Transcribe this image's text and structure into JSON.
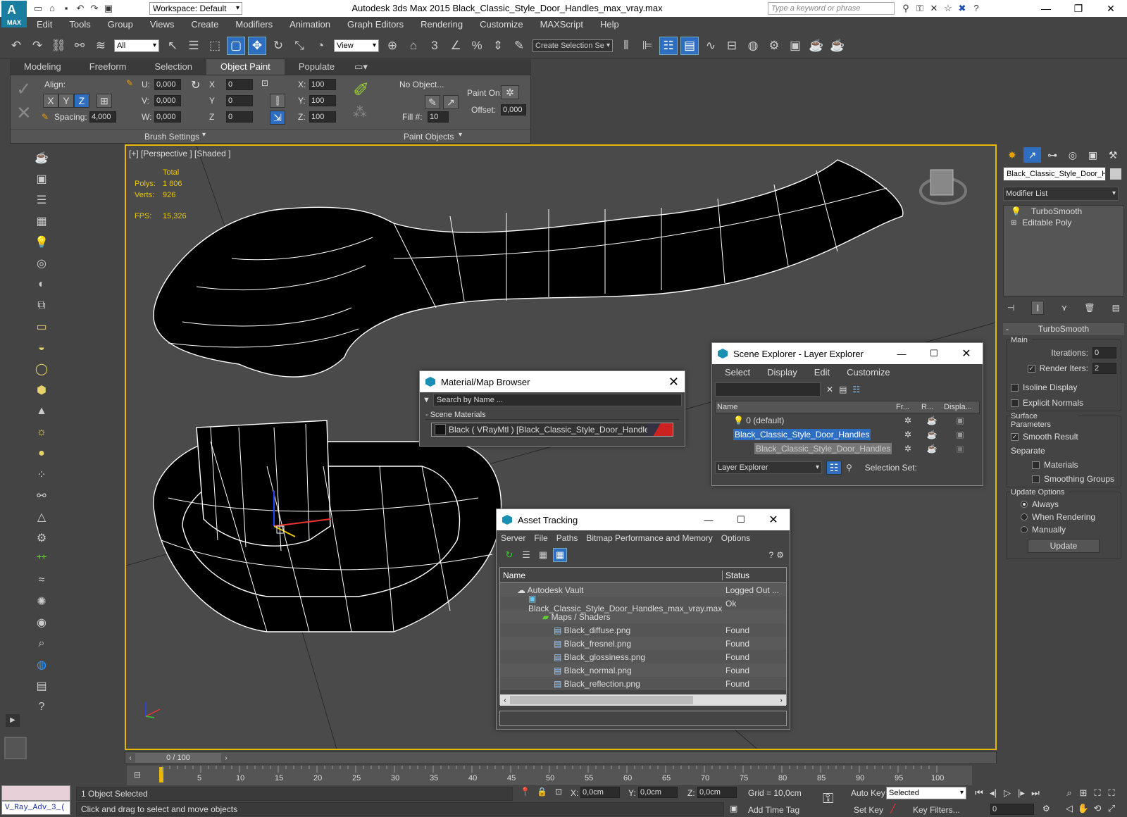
{
  "app": {
    "title": "Autodesk 3ds Max  2015    Black_Classic_Style_Door_Handles_max_vray.max",
    "logo": "MAX",
    "workspace": "Workspace: Default",
    "search_placeholder": "Type a keyword or phrase"
  },
  "menu": [
    "Edit",
    "Tools",
    "Group",
    "Views",
    "Create",
    "Modifiers",
    "Animation",
    "Graph Editors",
    "Rendering",
    "Customize",
    "MAXScript",
    "Help"
  ],
  "toolbar": {
    "selection_filter": "All",
    "ref_coord": "View",
    "snap_labels": [
      "3",
      "%"
    ],
    "named_selection": "Create Selection Se"
  },
  "ribbon": {
    "tabs": [
      "Modeling",
      "Freeform",
      "Selection",
      "Object Paint",
      "Populate"
    ],
    "active_tab": "Object Paint",
    "align_label": "Align:",
    "axes": [
      "X",
      "Y",
      "Z"
    ],
    "spacing_label": "Spacing:",
    "spacing": "4,000",
    "u_label": "U:",
    "u": "0,000",
    "v_label": "V:",
    "v": "0,000",
    "w_label": "W:",
    "w": "0,000",
    "rx_label": "X",
    "rx": "0",
    "ry_label": "Y",
    "ry": "0",
    "rz_label": "Z",
    "rz": "0",
    "sx_label": "X:",
    "sx": "100",
    "sy_label": "Y:",
    "sy": "100",
    "sz_label": "Z:",
    "sz": "100",
    "no_object": "No Object...",
    "fill_label": "Fill #:",
    "fill": "10",
    "paint_on_label": "Paint On:",
    "offset_label": "Offset:",
    "offset": "0,000",
    "brush_settings": "Brush Settings",
    "paint_objects": "Paint Objects"
  },
  "viewport": {
    "label": "[+] [Perspective ] [Shaded ]",
    "total_label": "Total",
    "polys_label": "Polys:",
    "polys": "1 806",
    "verts_label": "Verts:",
    "verts": "926",
    "fps_label": "FPS:",
    "fps": "15,326"
  },
  "command_panel": {
    "object_name": "Black_Classic_Style_Door_Ha",
    "modifier_list": "Modifier List",
    "stack": [
      "TurboSmooth",
      "Editable Poly"
    ],
    "rollout": "TurboSmooth",
    "main": "Main",
    "iterations_label": "Iterations:",
    "iterations": "0",
    "render_iters_label": "Render Iters:",
    "render_iters": "2",
    "isoline": "Isoline Display",
    "explicit": "Explicit Normals",
    "surface": "Surface Parameters",
    "smooth": "Smooth Result",
    "separate": "Separate",
    "materials": "Materials",
    "smoothing": "Smoothing Groups",
    "update_options": "Update Options",
    "always": "Always",
    "when_rendering": "When Rendering",
    "manually": "Manually",
    "update_btn": "Update"
  },
  "material_browser": {
    "title": "Material/Map Browser",
    "search_placeholder": "Search by Name ...",
    "section": "- Scene Materials",
    "item": "Black  ( VRayMtl ) [Black_Classic_Style_Door_Handles]"
  },
  "scene_explorer": {
    "title": "Scene Explorer - Layer Explorer",
    "menu": [
      "Select",
      "Display",
      "Edit",
      "Customize"
    ],
    "cols": [
      "Name",
      "Fr...",
      "R...",
      "Displa..."
    ],
    "rows": [
      "0 (default)",
      "Black_Classic_Style_Door_Handles",
      "Black_Classic_Style_Door_Handles"
    ],
    "footer_dd": "Layer Explorer",
    "selection_set": "Selection Set:"
  },
  "asset_tracking": {
    "title": "Asset Tracking",
    "menu": [
      "Server",
      "File",
      "Paths",
      "Bitmap Performance and Memory",
      "Options"
    ],
    "cols": [
      "Name",
      "Status"
    ],
    "rows": [
      {
        "name": "Autodesk Vault",
        "status": "Logged Out ..."
      },
      {
        "name": "Black_Classic_Style_Door_Handles_max_vray.max",
        "status": "Ok"
      },
      {
        "name": "Maps / Shaders",
        "status": ""
      },
      {
        "name": "Black_diffuse.png",
        "status": "Found"
      },
      {
        "name": "Black_fresnel.png",
        "status": "Found"
      },
      {
        "name": "Black_glossiness.png",
        "status": "Found"
      },
      {
        "name": "Black_normal.png",
        "status": "Found"
      },
      {
        "name": "Black_reflection.png",
        "status": "Found"
      }
    ]
  },
  "timeline": {
    "frame": "0 / 100",
    "ticks": [
      "5",
      "10",
      "15",
      "20",
      "25",
      "30",
      "35",
      "40",
      "45",
      "50",
      "55",
      "60",
      "65",
      "70",
      "75",
      "80",
      "85",
      "90",
      "95",
      "100"
    ]
  },
  "status": {
    "listener": "V_Ray_Adv_3_(",
    "selected": "1 Object Selected",
    "prompt": "Click and drag to select and move objects",
    "x_label": "X:",
    "x": "0,0cm",
    "y_label": "Y:",
    "y": "0,0cm",
    "z_label": "Z:",
    "z": "0,0cm",
    "grid": "Grid = 10,0cm",
    "add_time_tag": "Add Time Tag",
    "auto_key": "Auto Key",
    "set_key": "Set Key",
    "key_mode": "Selected",
    "key_filters": "Key Filters...",
    "frame": "0"
  }
}
